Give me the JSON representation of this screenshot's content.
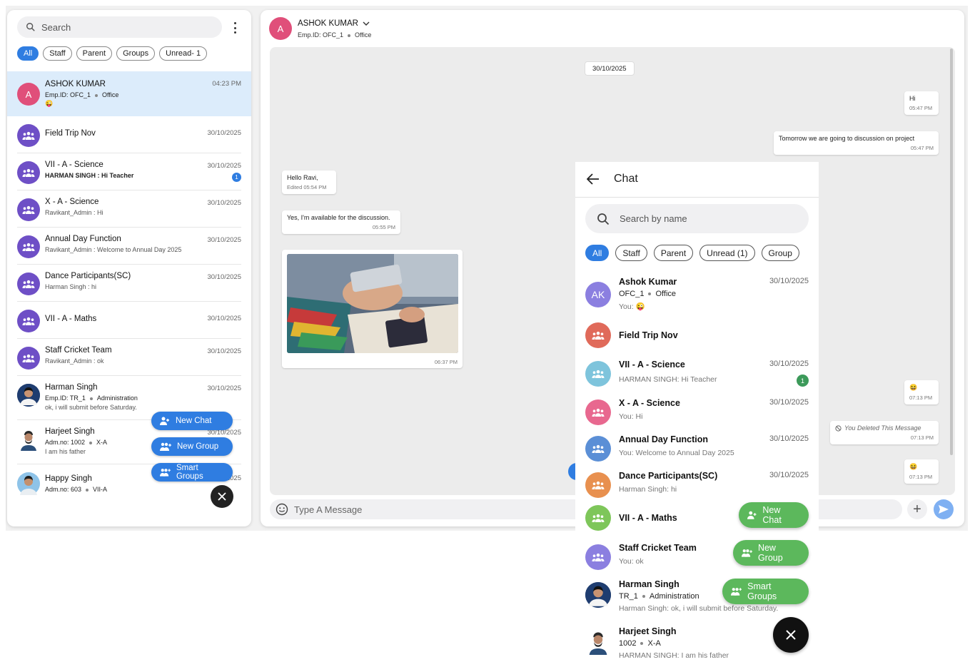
{
  "left": {
    "search_placeholder": "Search",
    "filters": [
      "All",
      "Staff",
      "Parent",
      "Groups",
      "Unread- 1"
    ],
    "conversations": [
      {
        "name": "ASHOK KUMAR",
        "sub": "Emp.ID: OFC_1",
        "sub_tag": "Office",
        "sub2": "😜",
        "time": "04:23 PM",
        "avatar_letter": "A"
      },
      {
        "name": "Field Trip Nov",
        "time": "30/10/2025"
      },
      {
        "name": "VII - A - Science",
        "sub": "HARMAN SINGH : Hi Teacher",
        "time": "30/10/2025",
        "unread": "1"
      },
      {
        "name": "X - A - Science",
        "sub": "Ravikant_Admin : Hi",
        "time": "30/10/2025"
      },
      {
        "name": "Annual Day Function",
        "sub": "Ravikant_Admin : Welcome to Annual Day 2025",
        "time": "30/10/2025"
      },
      {
        "name": "Dance Participants(SC)",
        "sub": "Harman Singh : hi",
        "time": "30/10/2025"
      },
      {
        "name": "VII - A - Maths",
        "time": "30/10/2025"
      },
      {
        "name": "Staff Cricket Team",
        "sub": "Ravikant_Admin : ok",
        "time": "30/10/2025"
      },
      {
        "name": "Harman Singh",
        "sub": "Emp.ID: TR_1",
        "sub_tag": "Administration",
        "sub2": "ok, i will submit before Saturday.",
        "time": "30/10/2025"
      },
      {
        "name": "Harjeet Singh",
        "sub": "Adm.no: 1002",
        "sub_tag": "X-A",
        "sub2": "I am his father",
        "time": "30/10/2025"
      },
      {
        "name": "Happy Singh",
        "sub": "Adm.no: 603",
        "sub_tag": "VII-A",
        "time": "30/10/2025"
      }
    ],
    "fab": {
      "new_chat": "New Chat",
      "new_group": "New Group",
      "smart_groups": "Smart Groups"
    }
  },
  "chat": {
    "header": {
      "avatar_letter": "A",
      "name": "ASHOK KUMAR",
      "emp_id": "Emp.ID: OFC_1",
      "dept": "Office"
    },
    "date_pill": "30/10/2025",
    "messages": [
      {
        "text": "Hi",
        "time": "05:47 PM"
      },
      {
        "text": "Tomorrow we are going to discussion on project",
        "time": "05:47 PM"
      },
      {
        "text": "Hello Ravi,",
        "time": "Edited 05:54 PM"
      },
      {
        "text": "Yes, I'm available for the discussion.",
        "time": "05:55 PM"
      },
      {
        "time": "06:37 PM"
      },
      {
        "text": "😆",
        "time": "07:13 PM"
      },
      {
        "text": "You Deleted This Message",
        "time": "07:13 PM"
      },
      {
        "text": "😆",
        "time": "07:13 PM"
      }
    ],
    "composer_placeholder": "Type A Message"
  },
  "mobile": {
    "title": "Chat",
    "search_placeholder": "Search by name",
    "filters": [
      "All",
      "Staff",
      "Parent",
      "Unread (1)",
      "Group"
    ],
    "items": [
      {
        "name": "Ashok Kumar",
        "s1": "OFC_1",
        "s1_tag": "Office",
        "s2": "You: 😜",
        "time": "30/10/2025",
        "initials": "AK"
      },
      {
        "name": "Field Trip Nov"
      },
      {
        "name": "VII - A - Science",
        "s2": "HARMAN SINGH: Hi Teacher",
        "time": "30/10/2025",
        "badge": "1"
      },
      {
        "name": "X - A - Science",
        "s2": "You: Hi",
        "time": "30/10/2025"
      },
      {
        "name": "Annual Day Function",
        "s2": "You: Welcome to Annual Day 2025",
        "time": "30/10/2025"
      },
      {
        "name": "Dance Participants(SC)",
        "s2": "Harman Singh: hi",
        "time": "30/10/2025"
      },
      {
        "name": "VII - A - Maths"
      },
      {
        "name": "Staff Cricket Team",
        "s2": "You: ok"
      },
      {
        "name": "Harman Singh",
        "s1": "TR_1",
        "s1_tag": "Administration",
        "s2": "Harman Singh: ok, i will submit before Saturday."
      },
      {
        "name": "Harjeet Singh",
        "s1": "1002",
        "s1_tag": "X-A",
        "s2": "HARMAN SINGH: I am his father"
      }
    ],
    "fab": {
      "new_chat": "New Chat",
      "new_group": "New Group",
      "smart_groups": "Smart Groups"
    }
  },
  "colors": {
    "accent": "#2f7de1",
    "group_avatar": "#6e4fc6",
    "mobile_fab": "#5cb85c",
    "selected_row": "#dcecfb"
  }
}
